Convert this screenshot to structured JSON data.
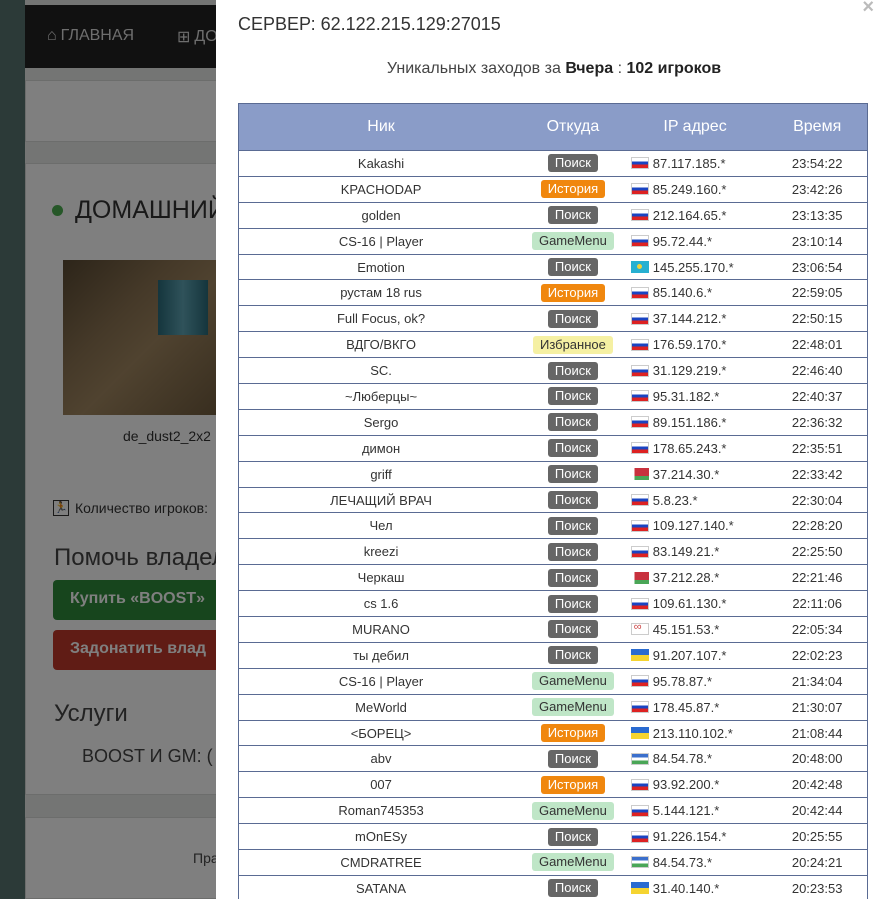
{
  "background": {
    "nav": {
      "home_label": "ГЛАВНАЯ",
      "add_label": "ДО"
    },
    "server_title": "ДОМАШНИЙ",
    "map_name": "de_dust2_2x2",
    "players_label": "Количество игроков:",
    "help_heading": "Помочь владел",
    "buy_boost_label": "Купить «BOOST»",
    "donate_label": "Задонатить влад",
    "services_heading": "Услуги",
    "boost_gm_label": "BOOST И GM:  (",
    "footer_text": "Пра"
  },
  "modal": {
    "close_label": "×",
    "server_label": "СЕРВЕР: 62.122.215.129:27015",
    "unique_prefix": "Уникальных заходов за",
    "unique_period": "Вчера",
    "unique_sep": ":",
    "unique_count": "102 игроков",
    "columns": {
      "nick": "Ник",
      "from": "Откуда",
      "ip": "IP адрес",
      "time": "Время"
    },
    "rows": [
      {
        "nick": "Kakashi",
        "from": "Поиск",
        "type": "search",
        "flag": "ru",
        "ip": "87.117.185.*",
        "time": "23:54:22"
      },
      {
        "nick": "KPACHODAP",
        "from": "История",
        "type": "history",
        "flag": "ru",
        "ip": "85.249.160.*",
        "time": "23:42:26"
      },
      {
        "nick": "golden",
        "from": "Поиск",
        "type": "search",
        "flag": "ru",
        "ip": "212.164.65.*",
        "time": "23:13:35"
      },
      {
        "nick": "CS-16 | Player",
        "from": "GameMenu",
        "type": "gm",
        "flag": "ru",
        "ip": "95.72.44.*",
        "time": "23:10:14"
      },
      {
        "nick": "Emotion",
        "from": "Поиск",
        "type": "search",
        "flag": "kz",
        "ip": "145.255.170.*",
        "time": "23:06:54"
      },
      {
        "nick": "рустам 18 rus",
        "from": "История",
        "type": "history",
        "flag": "ru",
        "ip": "85.140.6.*",
        "time": "22:59:05"
      },
      {
        "nick": "Full Focus, ok?",
        "from": "Поиск",
        "type": "search",
        "flag": "ru",
        "ip": "37.144.212.*",
        "time": "22:50:15"
      },
      {
        "nick": "ВДГО/ВКГО",
        "from": "Избранное",
        "type": "fav",
        "flag": "ru",
        "ip": "176.59.170.*",
        "time": "22:48:01"
      },
      {
        "nick": "SC.",
        "from": "Поиск",
        "type": "search",
        "flag": "ru",
        "ip": "31.129.219.*",
        "time": "22:46:40"
      },
      {
        "nick": "~Люберцы~",
        "from": "Поиск",
        "type": "search",
        "flag": "ru",
        "ip": "95.31.182.*",
        "time": "22:40:37"
      },
      {
        "nick": "Sergo",
        "from": "Поиск",
        "type": "search",
        "flag": "ru",
        "ip": "89.151.186.*",
        "time": "22:36:32"
      },
      {
        "nick": "димон",
        "from": "Поиск",
        "type": "search",
        "flag": "ru",
        "ip": "178.65.243.*",
        "time": "22:35:51"
      },
      {
        "nick": "griff",
        "from": "Поиск",
        "type": "search",
        "flag": "by",
        "ip": "37.214.30.*",
        "time": "22:33:42"
      },
      {
        "nick": "ЛЕЧАЩИЙ ВРАЧ",
        "from": "Поиск",
        "type": "search",
        "flag": "ru",
        "ip": "5.8.23.*",
        "time": "22:30:04"
      },
      {
        "nick": "Чел",
        "from": "Поиск",
        "type": "search",
        "flag": "ru",
        "ip": "109.127.140.*",
        "time": "22:28:20"
      },
      {
        "nick": "kreezi",
        "from": "Поиск",
        "type": "search",
        "flag": "ru",
        "ip": "83.149.21.*",
        "time": "22:25:50"
      },
      {
        "nick": "Черкаш",
        "from": "Поиск",
        "type": "search",
        "flag": "by",
        "ip": "37.212.28.*",
        "time": "22:21:46"
      },
      {
        "nick": "cs 1.6",
        "from": "Поиск",
        "type": "search",
        "flag": "ru",
        "ip": "109.61.130.*",
        "time": "22:11:06"
      },
      {
        "nick": "MURANO",
        "from": "Поиск",
        "type": "search",
        "flag": "oly",
        "ip": "45.151.53.*",
        "time": "22:05:34"
      },
      {
        "nick": "ты дебил",
        "from": "Поиск",
        "type": "search",
        "flag": "ua",
        "ip": "91.207.107.*",
        "time": "22:02:23"
      },
      {
        "nick": "CS-16 | Player",
        "from": "GameMenu",
        "type": "gm",
        "flag": "ru",
        "ip": "95.78.87.*",
        "time": "21:34:04"
      },
      {
        "nick": "MeWorld",
        "from": "GameMenu",
        "type": "gm",
        "flag": "ru",
        "ip": "178.45.87.*",
        "time": "21:30:07"
      },
      {
        "nick": "<БОРЕЦ>",
        "from": "История",
        "type": "history",
        "flag": "ua",
        "ip": "213.110.102.*",
        "time": "21:08:44"
      },
      {
        "nick": "abv",
        "from": "Поиск",
        "type": "search",
        "flag": "uz",
        "ip": "84.54.78.*",
        "time": "20:48:00"
      },
      {
        "nick": "007",
        "from": "История",
        "type": "history",
        "flag": "ru",
        "ip": "93.92.200.*",
        "time": "20:42:48"
      },
      {
        "nick": "Roman745353",
        "from": "GameMenu",
        "type": "gm",
        "flag": "ru",
        "ip": "5.144.121.*",
        "time": "20:42:44"
      },
      {
        "nick": "mOnESy",
        "from": "Поиск",
        "type": "search",
        "flag": "ru",
        "ip": "91.226.154.*",
        "time": "20:25:55"
      },
      {
        "nick": "CMDRATREE",
        "from": "GameMenu",
        "type": "gm",
        "flag": "uz",
        "ip": "84.54.73.*",
        "time": "20:24:21"
      },
      {
        "nick": "SATANA",
        "from": "Поиск",
        "type": "search",
        "flag": "ua",
        "ip": "31.40.140.*",
        "time": "20:23:53"
      }
    ]
  }
}
